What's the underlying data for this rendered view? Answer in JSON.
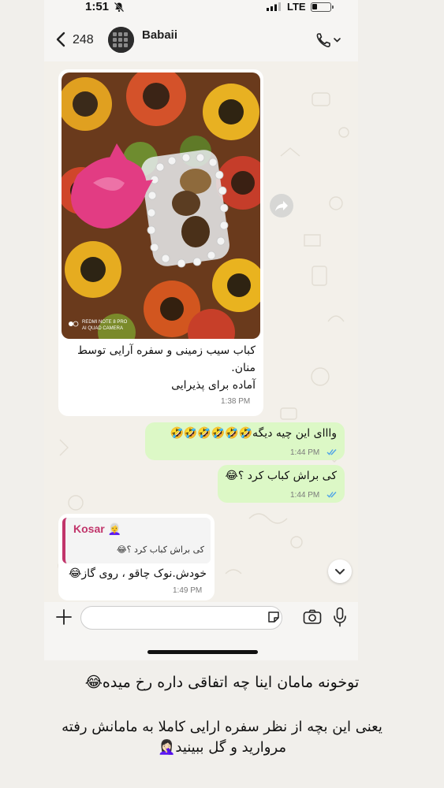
{
  "status_bar": {
    "time": "1:51",
    "network": "LTE",
    "battery_level": 0.3
  },
  "header": {
    "back_count": "248",
    "contact_name": "Babaii"
  },
  "messages": {
    "photo": {
      "caption_line1": "کباب سیب زمینی و سفره آرایی توسط",
      "caption_line2": "منان.",
      "caption_line3": "آماده برای پذیرایی",
      "watermark_line1": "REDMI NOTE 8 PRO",
      "watermark_line2": "AI QUAD CAMERA",
      "time": "1:38 PM"
    },
    "out1": {
      "text": "وااای این چیه دیگه🤣🤣🤣🤣🤣🤣",
      "time": "1:44 PM"
    },
    "out2": {
      "text": "کی براش کباب کرد ؟😂",
      "time": "1:44 PM"
    },
    "reply": {
      "quote_name": "Kosar 👩‍🦳",
      "quote_text": "کی براش کباب کرد ؟😂",
      "text": "خودش.نوک چاقو ، روی گاز😂",
      "time": "1:49 PM"
    }
  },
  "input": {
    "placeholder": ""
  },
  "captions": {
    "line1": "توخونه مامان اینا چه اتفاقی داره رخ میده😂",
    "line2": "یعنی این بچه از نظر سفره ارایی کاملا به مامانش رفته",
    "line3": "مروارید و گل ببینید🤦🏻‍♀️"
  },
  "icons": {
    "mute": "bell-slash-icon",
    "back": "chevron-left-icon",
    "call": "phone-icon",
    "forward": "forward-arrow-icon",
    "scroll": "chevron-down-icon",
    "attach": "plus-icon",
    "sticker": "sticker-icon",
    "camera": "camera-icon",
    "mic": "microphone-icon",
    "read": "double-check-icon"
  },
  "colors": {
    "outgoing_bubble": "#dcf8c6",
    "incoming_bubble": "#ffffff",
    "read_ticks": "#4fa3e8",
    "quote_accent": "#c1356b"
  }
}
